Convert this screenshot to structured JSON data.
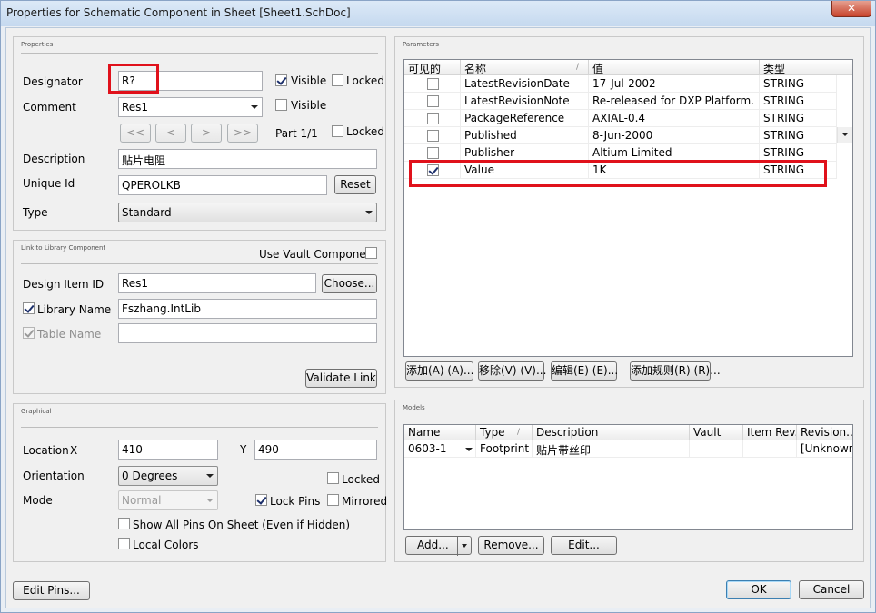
{
  "window": {
    "title": "Properties for Schematic Component in Sheet [Sheet1.SchDoc]",
    "close_glyph": "✕"
  },
  "properties": {
    "group_title": "Properties",
    "designator_label": "Designator",
    "designator_value": "R?",
    "visible_label": "Visible",
    "locked_label": "Locked",
    "comment_label": "Comment",
    "comment_value": "Res1",
    "part_first": "<<",
    "part_prev": "<",
    "part_next": ">",
    "part_last": ">>",
    "part_label": "Part 1/1",
    "description_label": "Description",
    "description_value": "贴片电阻",
    "unique_id_label": "Unique Id",
    "unique_id_value": "QPEROLKB",
    "reset_label": "Reset",
    "type_label": "Type",
    "type_value": "Standard"
  },
  "link": {
    "group_title": "Link to Library Component",
    "use_vault_label": "Use Vault Component",
    "design_item_label": "Design Item ID",
    "design_item_value": "Res1",
    "choose_label": "Choose...",
    "library_name_label": "Library Name",
    "library_name_value": "Fszhang.IntLib",
    "table_name_label": "Table Name",
    "table_name_value": "",
    "validate_label": "Validate Link"
  },
  "graphical": {
    "group_title": "Graphical",
    "location_label": "Location",
    "x_label": "X",
    "x_value": "410",
    "y_label": "Y",
    "y_value": "490",
    "orientation_label": "Orientation",
    "orientation_value": "0 Degrees",
    "locked_label": "Locked",
    "mode_label": "Mode",
    "mode_value": "Normal",
    "lock_pins_label": "Lock Pins",
    "mirrored_label": "Mirrored",
    "show_all_pins_label": "Show All Pins On Sheet (Even if Hidden)",
    "local_colors_label": "Local Colors"
  },
  "parameters": {
    "group_title": "Parameters",
    "columns": [
      "可见的",
      "名称",
      "值",
      "类型"
    ],
    "rows": [
      {
        "visible": false,
        "name": "LatestRevisionDate",
        "value": "17-Jul-2002",
        "type": "STRING"
      },
      {
        "visible": false,
        "name": "LatestRevisionNote",
        "value": "Re-released for DXP Platform.",
        "type": "STRING"
      },
      {
        "visible": false,
        "name": "PackageReference",
        "value": "AXIAL-0.4",
        "type": "STRING"
      },
      {
        "visible": false,
        "name": "Published",
        "value": "8-Jun-2000",
        "type": "STRING"
      },
      {
        "visible": false,
        "name": "Publisher",
        "value": "Altium Limited",
        "type": "STRING"
      },
      {
        "visible": true,
        "name": "Value",
        "value": "1K",
        "type": "STRING"
      }
    ],
    "add_label": "添加(A) (A)...",
    "remove_label": "移除(V) (V)...",
    "edit_label": "编辑(E) (E)...",
    "add_rule_label": "添加规则(R) (R)..."
  },
  "models": {
    "group_title": "Models",
    "columns": [
      "Name",
      "Type",
      "Description",
      "Vault",
      "Item Rev...",
      "Revision..."
    ],
    "rows": [
      {
        "name": "0603-1",
        "type": "Footprint",
        "description": "贴片带丝印",
        "vault": "",
        "item_rev": "",
        "revision": "[Unknown]"
      }
    ],
    "add_label": "Add...",
    "remove_label": "Remove...",
    "edit_label": "Edit..."
  },
  "footer": {
    "edit_pins_label": "Edit Pins...",
    "ok_label": "OK",
    "cancel_label": "Cancel"
  }
}
